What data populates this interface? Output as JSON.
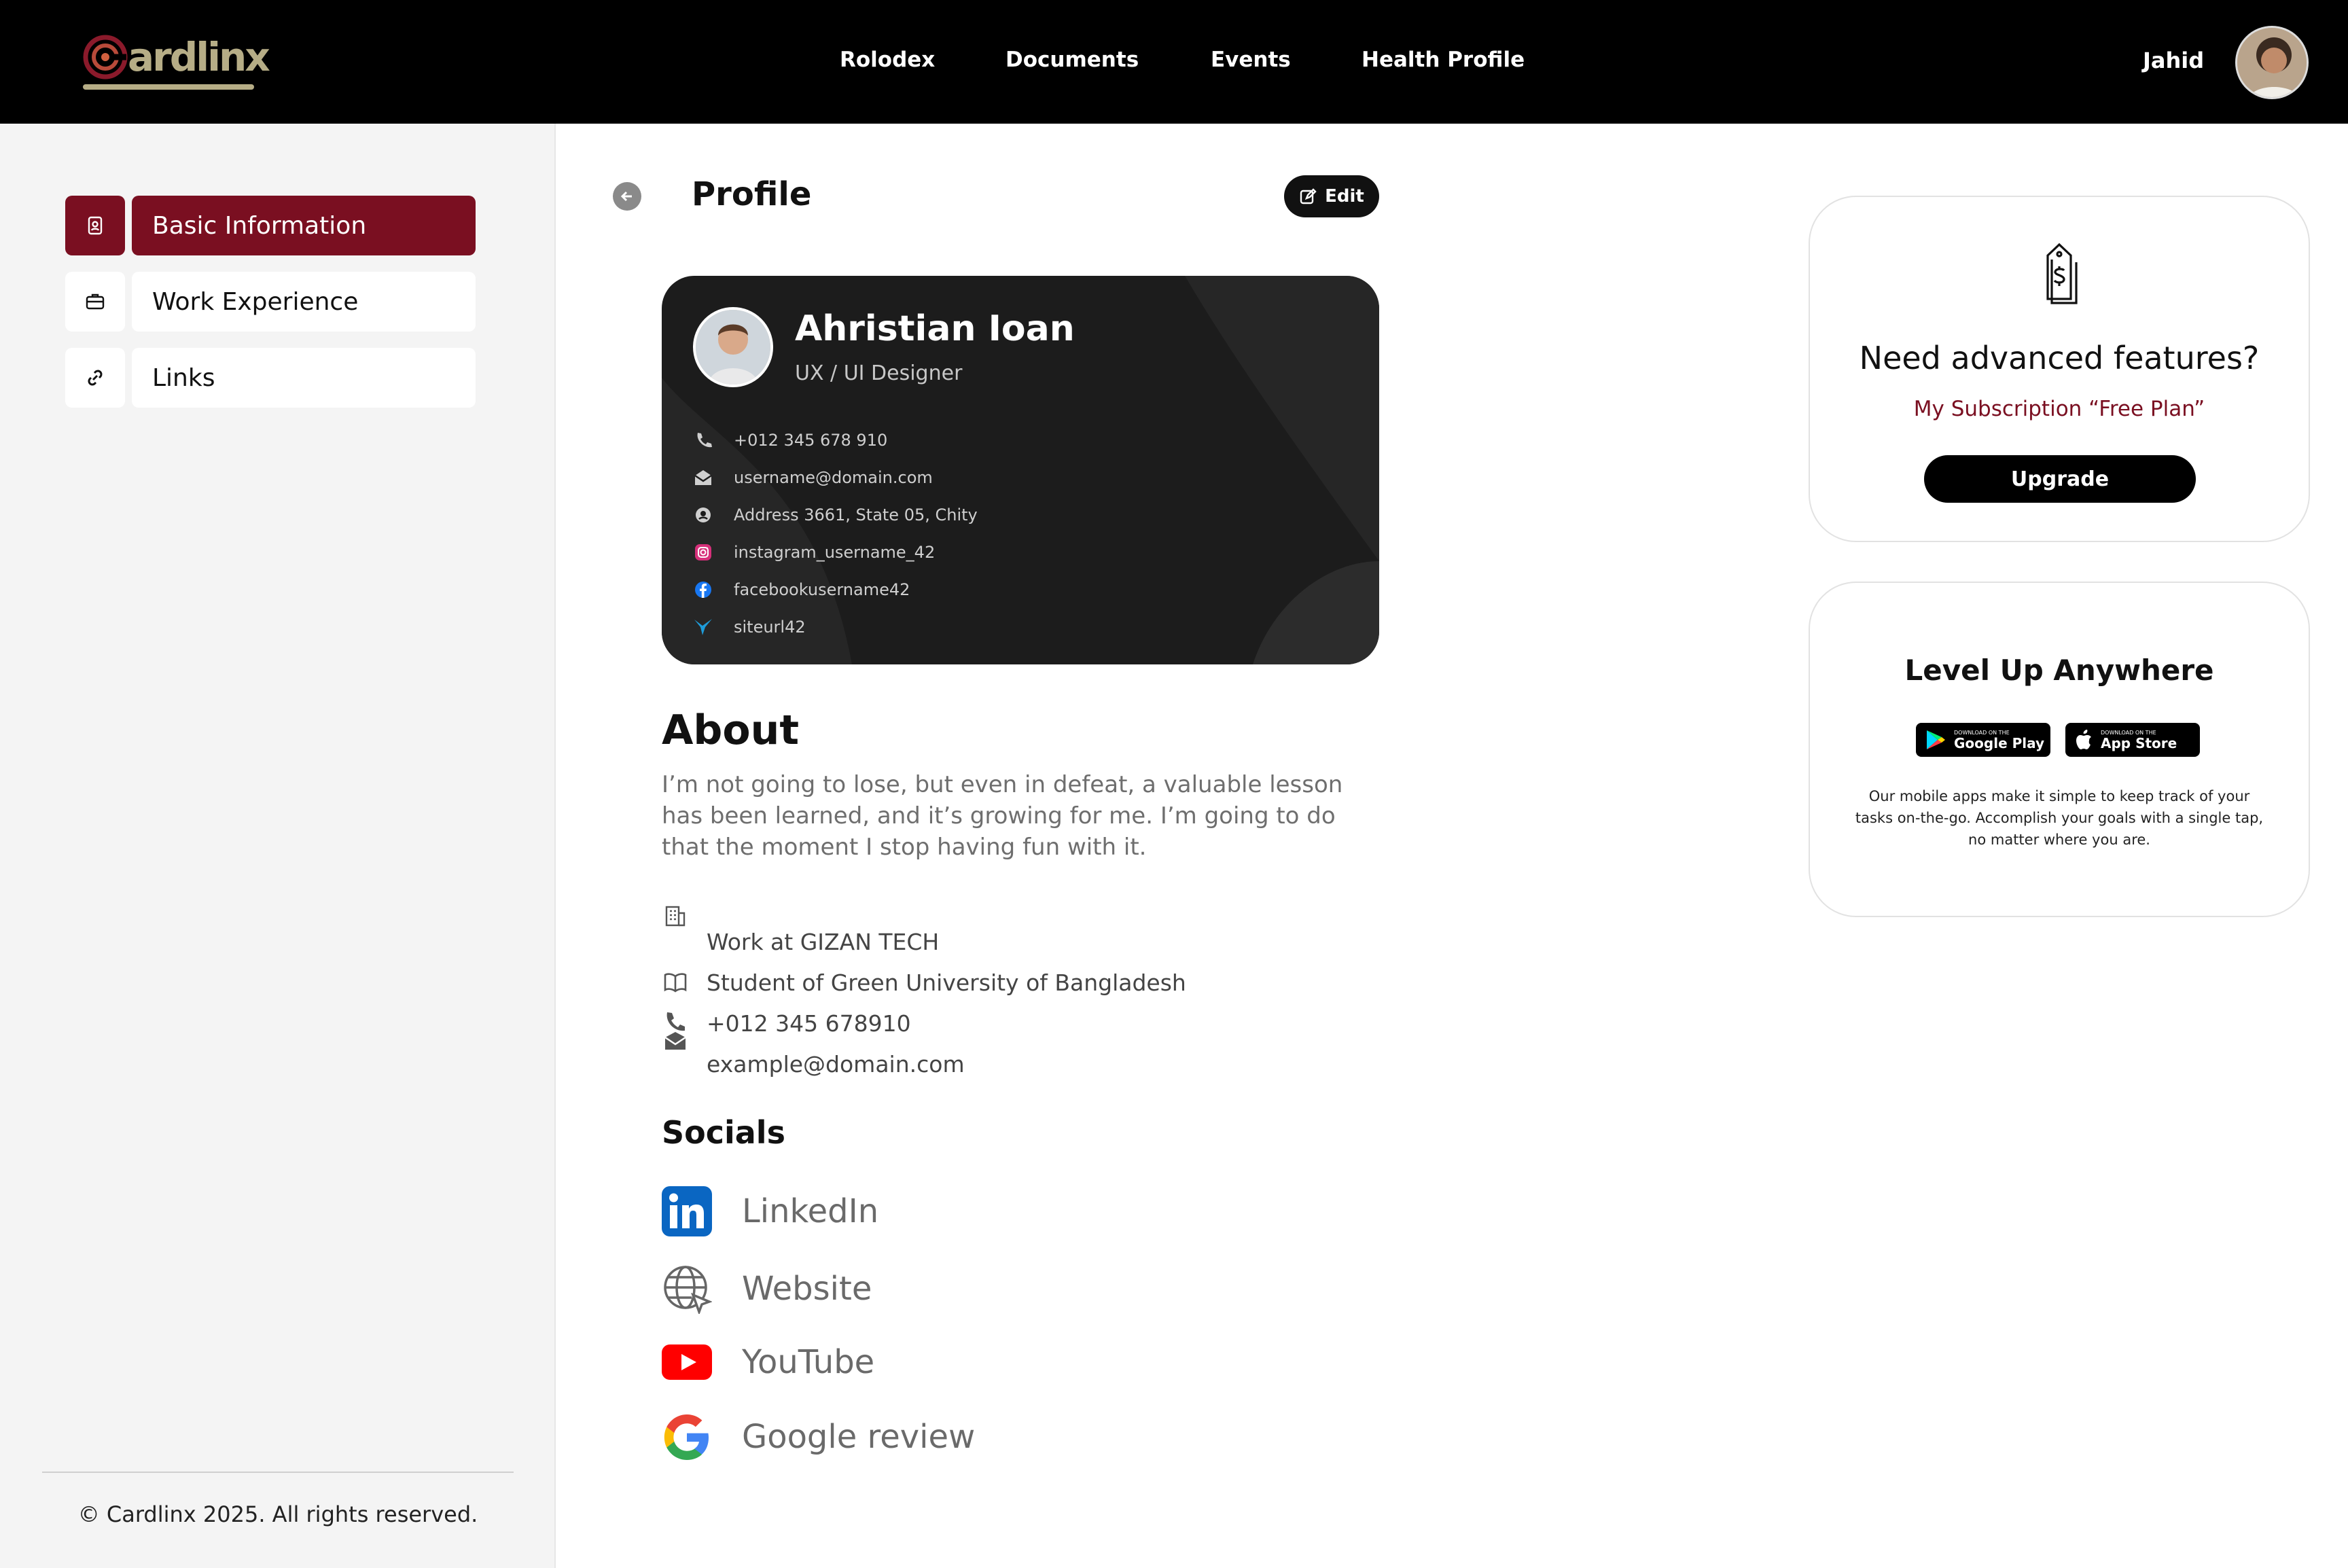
{
  "header": {
    "logo_text": "ardlinx",
    "nav": [
      "Rolodex",
      "Documents",
      "Events",
      "Health Profile"
    ],
    "user_name": "Jahid"
  },
  "sidebar": {
    "items": [
      {
        "label": "Basic Information",
        "icon": "id-card-icon",
        "active": true
      },
      {
        "label": "Work Experience",
        "icon": "briefcase-icon",
        "active": false
      },
      {
        "label": "Links",
        "icon": "link-icon",
        "active": false
      }
    ],
    "copyright": "© Cardlinx 2025. All rights reserved."
  },
  "main": {
    "title": "Profile",
    "edit_label": "Edit",
    "card": {
      "name": "Ahristian Ioan",
      "role": "UX / UI Designer",
      "phone": "+012 345 678 910",
      "email": "username@domain.com",
      "address": "Address 3661, State 05, Chity",
      "instagram": "instagram_username_42",
      "facebook": "facebookusername42",
      "site": "siteurl42"
    },
    "about_heading": "About",
    "about_text": "I’m not going to lose, but even in defeat, a valuable lesson has been learned, and it’s growing for me. I’m going to do that the moment I stop having fun with it.",
    "info": {
      "work": "Work at GIZAN TECH",
      "education": "Student of Green University of Bangladesh",
      "phone": "+012 345 678910",
      "email": "example@domain.com"
    },
    "socials_heading": "Socials",
    "socials": [
      {
        "label": "LinkedIn",
        "icon": "linkedin-icon"
      },
      {
        "label": "Website",
        "icon": "globe-icon"
      },
      {
        "label": "YouTube",
        "icon": "youtube-icon"
      },
      {
        "label": "Google review",
        "icon": "google-icon"
      }
    ]
  },
  "upgrade_panel": {
    "title": "Need advanced features?",
    "subscription": "My Subscription “Free Plan”",
    "button": "Upgrade"
  },
  "apps_panel": {
    "title": "Level Up Anywhere",
    "google_play_small": "DOWNLOAD ON THE",
    "google_play": "Google Play",
    "app_store_small": "DOWNLOAD ON THE",
    "app_store": "App Store",
    "text": "Our mobile apps make it simple to keep track of your tasks on-the-go. Accomplish your goals with a single tap, no matter where you are."
  },
  "colors": {
    "brand": "#7a0f21",
    "logo_gold": "#b6ad86",
    "header_bg": "#000000",
    "sidebar_bg": "#f4f4f4",
    "card_bg": "#1c1c1c"
  }
}
